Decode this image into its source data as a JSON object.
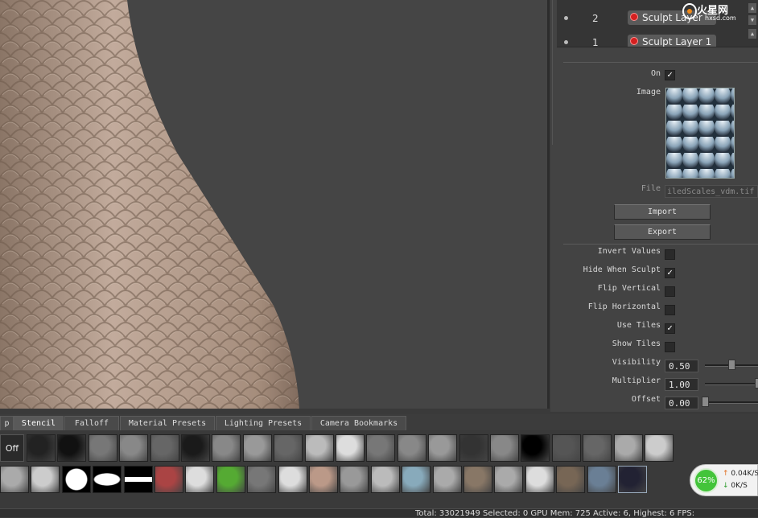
{
  "layers": [
    {
      "number": "2",
      "name": "Sculpt Layer"
    },
    {
      "number": "1",
      "name": "Sculpt Layer 1"
    }
  ],
  "stencil": {
    "on_label": "On",
    "on_checked": true,
    "image_label": "Image",
    "file_label": "File",
    "file_value": "iledScales_vdm.tif",
    "import_label": "Import",
    "export_label": "Export",
    "invert_values_label": "Invert Values",
    "invert_values_checked": false,
    "hide_when_sculpt_label": "Hide When Sculpt",
    "hide_when_sculpt_checked": true,
    "flip_vertical_label": "Flip Vertical",
    "flip_vertical_checked": false,
    "flip_horizontal_label": "Flip Horizontal",
    "flip_horizontal_checked": false,
    "use_tiles_label": "Use Tiles",
    "use_tiles_checked": true,
    "show_tiles_label": "Show Tiles",
    "show_tiles_checked": false,
    "visibility_label": "Visibility",
    "visibility_value": "0.50",
    "visibility_fraction": 0.5,
    "multiplier_label": "Multiplier",
    "multiplier_value": "1.00",
    "multiplier_fraction": 1.0,
    "offset_label": "Offset",
    "offset_value": "0.00",
    "offset_fraction": 0.0
  },
  "tabs": [
    {
      "label": "p",
      "active": false
    },
    {
      "label": "Stencil",
      "active": true
    },
    {
      "label": "Falloff",
      "active": false
    },
    {
      "label": "Material Presets",
      "active": false
    },
    {
      "label": "Lighting Presets",
      "active": false
    },
    {
      "label": "Camera Bookmarks",
      "active": false
    }
  ],
  "shelf": {
    "off_label": "Off"
  },
  "status_bar": {
    "text": "Total: 33021949 Selected: 0 GPU Mem: 725 Active: 6, Highest: 6 FPS:"
  },
  "network": {
    "percent": "62%",
    "up_rate": "0.04K/S",
    "down_rate": "0K/S"
  },
  "watermark": {
    "brand": "火星网",
    "url": "hxsd.com"
  },
  "colors": {
    "panel_bg": "#434343",
    "viewport_bg": "#454545",
    "gauge_green": "#43c43a"
  }
}
